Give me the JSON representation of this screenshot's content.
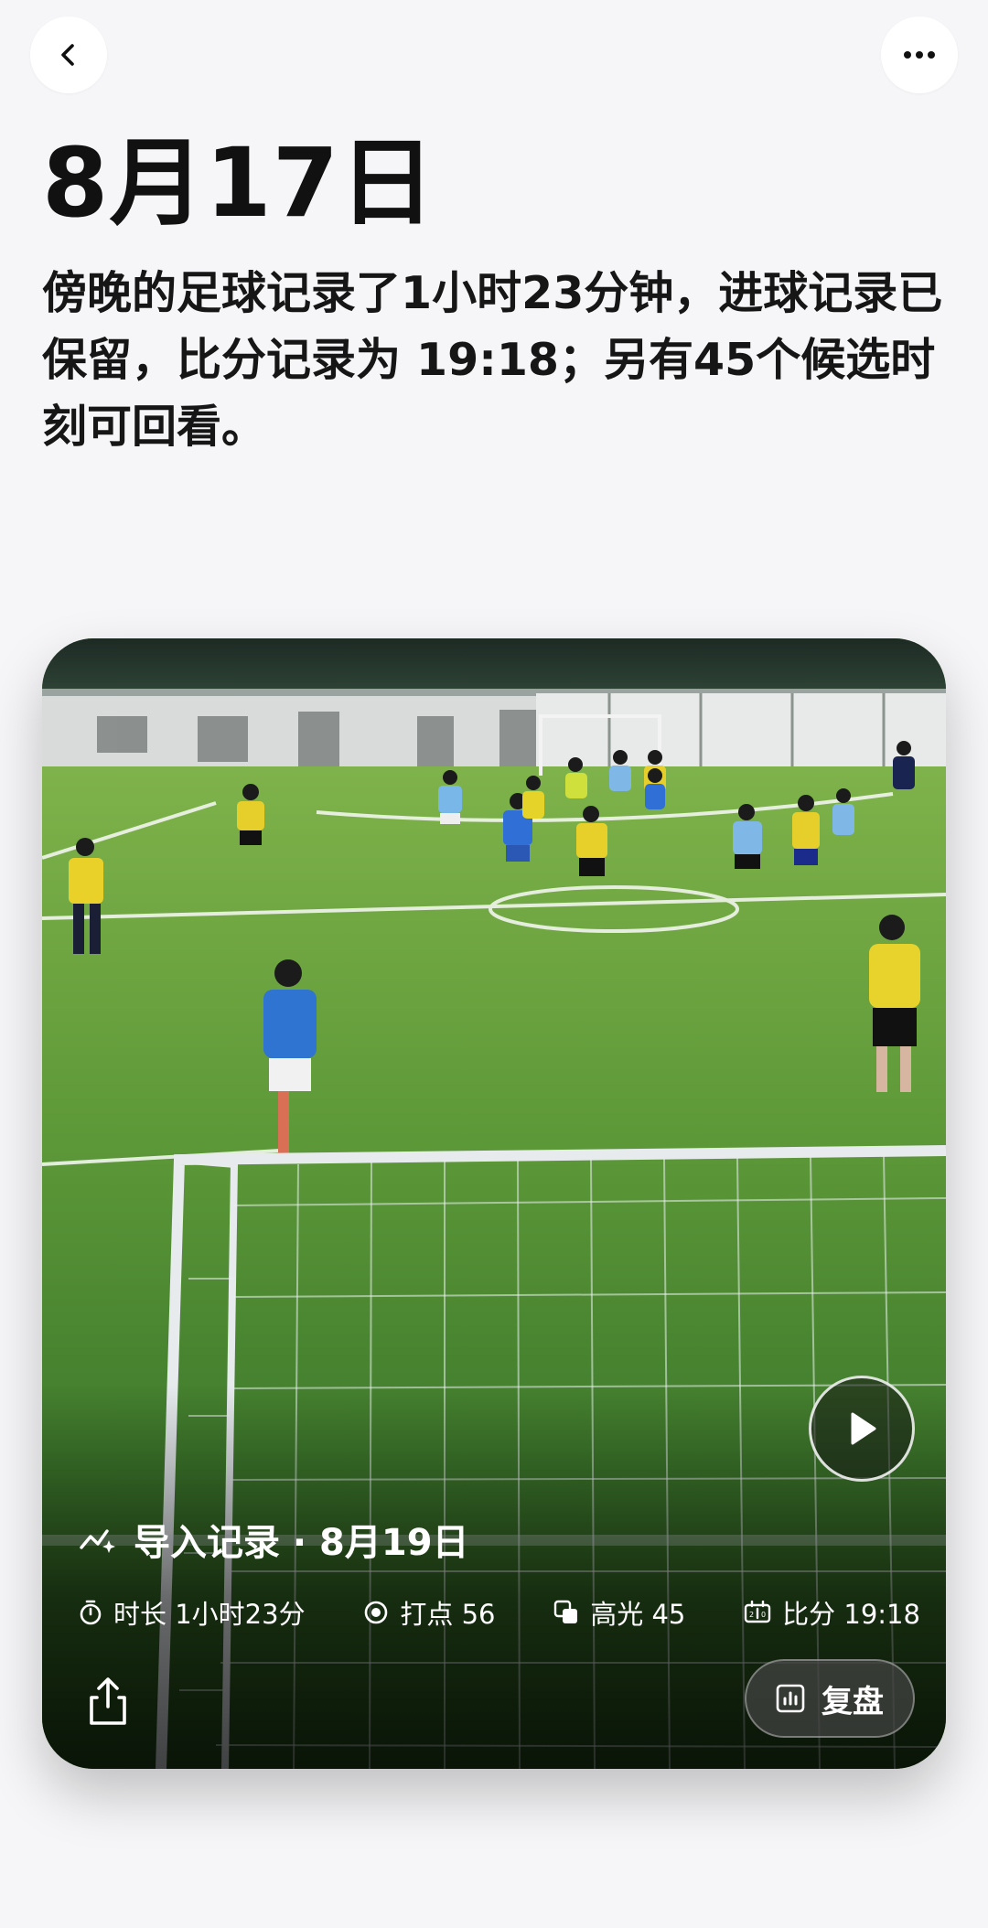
{
  "nav": {
    "back_icon": "chevron-left-icon",
    "more_icon": "ellipsis-icon"
  },
  "title": "8月17日",
  "summary": "傍晚的足球记录了1小时23分钟，进球记录已保留，比分记录为 19:18；另有45个候选时刻可回看。",
  "card": {
    "import_label": "导入记录 · 8月19日",
    "stats": [
      {
        "icon": "timer-icon",
        "label": "时长 1小时23分"
      },
      {
        "icon": "target-icon",
        "label": "打点 56"
      },
      {
        "icon": "highlights-icon",
        "label": "高光 45"
      },
      {
        "icon": "scoreboard-icon",
        "label": "比分 19:18"
      }
    ],
    "review_label": "复盘",
    "play_icon": "play-icon",
    "share_icon": "share-icon"
  }
}
